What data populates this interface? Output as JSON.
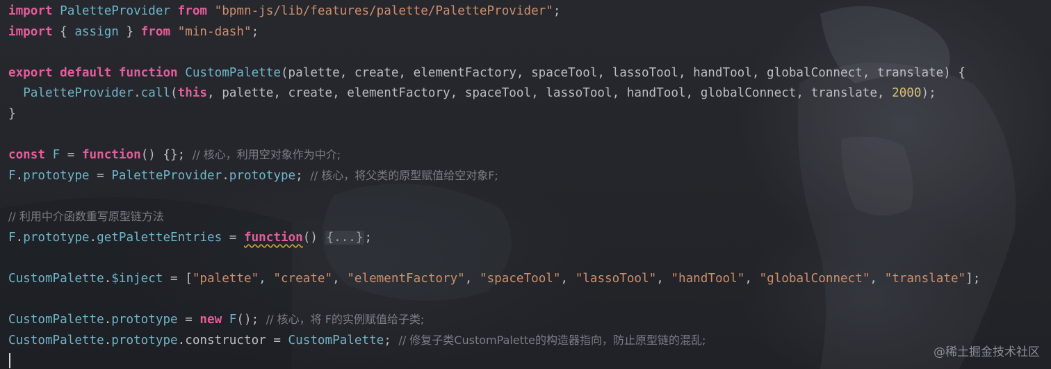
{
  "editor": {
    "lines": [
      [
        {
          "t": "import",
          "c": "kw2"
        },
        {
          "t": " ",
          "c": "plain"
        },
        {
          "t": "PaletteProvider",
          "c": "cls"
        },
        {
          "t": " ",
          "c": "plain"
        },
        {
          "t": "from",
          "c": "kw2"
        },
        {
          "t": " ",
          "c": "plain"
        },
        {
          "t": "\"bpmn-js/lib/features/palette/PaletteProvider\"",
          "c": "str"
        },
        {
          "t": ";",
          "c": "plain"
        }
      ],
      [
        {
          "t": "import",
          "c": "kw2"
        },
        {
          "t": " { ",
          "c": "plain"
        },
        {
          "t": "assign",
          "c": "cls"
        },
        {
          "t": " } ",
          "c": "plain"
        },
        {
          "t": "from",
          "c": "kw2"
        },
        {
          "t": " ",
          "c": "plain"
        },
        {
          "t": "\"min-dash\"",
          "c": "str"
        },
        {
          "t": ";",
          "c": "plain"
        }
      ],
      [],
      [
        {
          "t": "export",
          "c": "kw2"
        },
        {
          "t": " ",
          "c": "plain"
        },
        {
          "t": "default",
          "c": "kw2"
        },
        {
          "t": " ",
          "c": "plain"
        },
        {
          "t": "function",
          "c": "kw2"
        },
        {
          "t": " ",
          "c": "plain"
        },
        {
          "t": "CustomPalette",
          "c": "cls"
        },
        {
          "t": "(palette, create, elementFactory, spaceTool, lassoTool, handTool, globalConnect, translate) {",
          "c": "plain"
        }
      ],
      [
        {
          "t": "  ",
          "c": "plain"
        },
        {
          "t": "PaletteProvider",
          "c": "cls"
        },
        {
          "t": ".",
          "c": "plain"
        },
        {
          "t": "call",
          "c": "cls"
        },
        {
          "t": "(",
          "c": "plain"
        },
        {
          "t": "this",
          "c": "kw2"
        },
        {
          "t": ", palette, create, elementFactory, spaceTool, lassoTool, handTool, globalConnect, translate, ",
          "c": "plain"
        },
        {
          "t": "2000",
          "c": "num"
        },
        {
          "t": ");",
          "c": "plain"
        }
      ],
      [
        {
          "t": "}",
          "c": "plain"
        }
      ],
      [],
      [
        {
          "t": "const",
          "c": "kw2"
        },
        {
          "t": " ",
          "c": "plain"
        },
        {
          "t": "F",
          "c": "cls"
        },
        {
          "t": " = ",
          "c": "plain"
        },
        {
          "t": "function",
          "c": "kw2"
        },
        {
          "t": "() {}; ",
          "c": "plain"
        },
        {
          "t": "// 核心，利用空对象作为中介;",
          "c": "cmt"
        }
      ],
      [
        {
          "t": "F",
          "c": "cls"
        },
        {
          "t": ".",
          "c": "plain"
        },
        {
          "t": "prototype",
          "c": "prop"
        },
        {
          "t": " = ",
          "c": "plain"
        },
        {
          "t": "PaletteProvider",
          "c": "cls"
        },
        {
          "t": ".",
          "c": "plain"
        },
        {
          "t": "prototype",
          "c": "prop"
        },
        {
          "t": "; ",
          "c": "plain"
        },
        {
          "t": "// 核心，将父类的原型赋值给空对象F;",
          "c": "cmt"
        }
      ],
      [],
      [
        {
          "t": "// 利用中介函数重写原型链方法",
          "c": "cmt"
        }
      ],
      [
        {
          "t": "F",
          "c": "cls"
        },
        {
          "t": ".",
          "c": "plain"
        },
        {
          "t": "prototype",
          "c": "prop"
        },
        {
          "t": ".",
          "c": "plain"
        },
        {
          "t": "getPaletteEntries",
          "c": "cls"
        },
        {
          "t": " = ",
          "c": "plain"
        },
        {
          "t": "function",
          "c": "kw2 squiggle"
        },
        {
          "t": "() ",
          "c": "plain"
        },
        {
          "t": "{...}",
          "c": "fold"
        },
        {
          "t": ";",
          "c": "plain"
        }
      ],
      [],
      [
        {
          "t": "CustomPalette",
          "c": "cls"
        },
        {
          "t": ".",
          "c": "plain"
        },
        {
          "t": "$inject",
          "c": "prop"
        },
        {
          "t": " = [",
          "c": "plain"
        },
        {
          "t": "\"palette\"",
          "c": "str"
        },
        {
          "t": ", ",
          "c": "plain"
        },
        {
          "t": "\"create\"",
          "c": "str"
        },
        {
          "t": ", ",
          "c": "plain"
        },
        {
          "t": "\"elementFactory\"",
          "c": "str"
        },
        {
          "t": ", ",
          "c": "plain"
        },
        {
          "t": "\"spaceTool\"",
          "c": "str"
        },
        {
          "t": ", ",
          "c": "plain"
        },
        {
          "t": "\"lassoTool\"",
          "c": "str"
        },
        {
          "t": ", ",
          "c": "plain"
        },
        {
          "t": "\"handTool\"",
          "c": "str"
        },
        {
          "t": ", ",
          "c": "plain"
        },
        {
          "t": "\"globalConnect\"",
          "c": "str"
        },
        {
          "t": ", ",
          "c": "plain"
        },
        {
          "t": "\"translate\"",
          "c": "str"
        },
        {
          "t": "];",
          "c": "plain"
        }
      ],
      [],
      [
        {
          "t": "CustomPalette",
          "c": "cls"
        },
        {
          "t": ".",
          "c": "plain"
        },
        {
          "t": "prototype",
          "c": "prop"
        },
        {
          "t": " = ",
          "c": "plain"
        },
        {
          "t": "new",
          "c": "kw2"
        },
        {
          "t": " ",
          "c": "plain"
        },
        {
          "t": "F",
          "c": "cls"
        },
        {
          "t": "(); ",
          "c": "plain"
        },
        {
          "t": "// 核心，将 F的实例赋值给子类;",
          "c": "cmt"
        }
      ],
      [
        {
          "t": "CustomPalette",
          "c": "cls"
        },
        {
          "t": ".",
          "c": "plain"
        },
        {
          "t": "prototype",
          "c": "prop"
        },
        {
          "t": ".",
          "c": "plain"
        },
        {
          "t": "constructor",
          "c": "plain"
        },
        {
          "t": " = ",
          "c": "plain"
        },
        {
          "t": "CustomPalette",
          "c": "cls"
        },
        {
          "t": "; ",
          "c": "plain"
        },
        {
          "t": "// 修复子类CustomPalette的构造器指向，防止原型链的混乱;",
          "c": "cmt"
        }
      ],
      []
    ]
  },
  "watermark": "@稀土掘金技术社区",
  "colors": {
    "background": "#23252b",
    "keyword": "#e25e9a",
    "string": "#ce8e6d",
    "identifier": "#6fb5c8",
    "number": "#d8c27a",
    "comment": "#7a7e85",
    "text": "#bcbec4"
  }
}
